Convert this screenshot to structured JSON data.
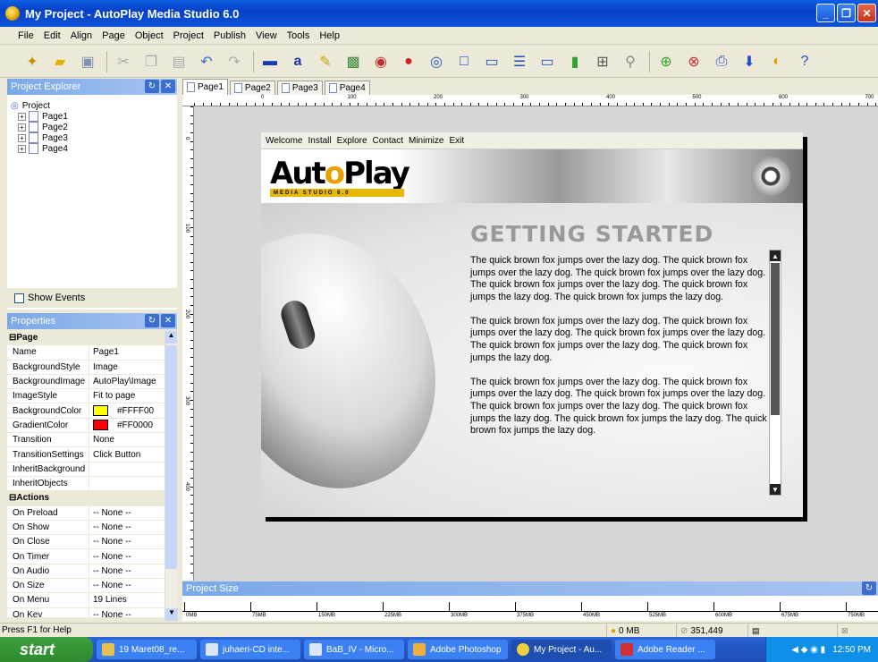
{
  "window": {
    "title": "My Project - AutoPlay Media Studio 6.0"
  },
  "menu": [
    "File",
    "Edit",
    "Align",
    "Page",
    "Object",
    "Project",
    "Publish",
    "View",
    "Tools",
    "Help"
  ],
  "explorer": {
    "title": "Project Explorer",
    "root": "Project",
    "pages": [
      "Page1",
      "Page2",
      "Page3",
      "Page4"
    ],
    "show_events": "Show Events"
  },
  "properties": {
    "title": "Properties",
    "page_section": "Page",
    "page_rows": [
      {
        "k": "Name",
        "v": "Page1"
      },
      {
        "k": "BackgroundStyle",
        "v": "Image"
      },
      {
        "k": "BackgroundImage",
        "v": "AutoPlay\\Image"
      },
      {
        "k": "ImageStyle",
        "v": "Fit to page"
      },
      {
        "k": "BackgroundColor",
        "v": "#FFFF00",
        "color": "#FFFF00"
      },
      {
        "k": "GradientColor",
        "v": "#FF0000",
        "color": "#FF0000"
      },
      {
        "k": "Transition",
        "v": "None"
      },
      {
        "k": "TransitionSettings",
        "v": "Click Button"
      },
      {
        "k": "InheritBackground",
        "v": ""
      },
      {
        "k": "InheritObjects",
        "v": ""
      }
    ],
    "actions_section": "Actions",
    "action_rows": [
      {
        "k": "On Preload",
        "v": "-- None --"
      },
      {
        "k": "On Show",
        "v": "-- None --"
      },
      {
        "k": "On Close",
        "v": "-- None --"
      },
      {
        "k": "On Timer",
        "v": "-- None --"
      },
      {
        "k": "On Audio",
        "v": "-- None --"
      },
      {
        "k": "On Size",
        "v": "-- None --"
      },
      {
        "k": "On Menu",
        "v": "19 Lines"
      },
      {
        "k": "On Key",
        "v": "-- None --"
      }
    ]
  },
  "tabs": [
    "Page1",
    "Page2",
    "Page3",
    "Page4"
  ],
  "ruler_h": [
    "0",
    "100",
    "200",
    "300",
    "400",
    "500",
    "600",
    "700"
  ],
  "ruler_v": [
    "0",
    "100",
    "200",
    "300",
    "400"
  ],
  "stage": {
    "menu": [
      "Welcome",
      "Install",
      "Explore",
      "Contact",
      "Minimize",
      "Exit"
    ],
    "logo_main": "Aut",
    "logo_o": "o",
    "logo_end": "Play",
    "logo_sub": "MEDIA STUDIO 6.0",
    "heading": "GETTING STARTED",
    "paragraphs": [
      "The quick brown fox jumps over the lazy dog. The quick brown fox jumps over the lazy dog. The quick brown fox jumps over the lazy dog. The quick brown fox jumps over the lazy dog. The quick brown fox jumps the lazy dog. The quick brown fox jumps the lazy dog.",
      "The quick brown fox jumps over the lazy dog. The quick brown fox jumps over the lazy dog. The quick brown fox jumps over the lazy dog. The quick brown fox jumps over the lazy dog. The quick brown fox jumps the lazy dog.",
      "The quick brown fox jumps over the lazy dog. The quick brown fox jumps over the lazy dog. The quick brown fox jumps over the lazy dog. The quick brown fox jumps over the lazy dog. The quick brown fox jumps the lazy dog. The quick brown fox jumps the lazy dog. The quick brown fox jumps the lazy dog."
    ]
  },
  "project_size": {
    "title": "Project Size",
    "labels": [
      "0MB",
      "75MB",
      "150MB",
      "225MB",
      "300MB",
      "375MB",
      "450MB",
      "525MB",
      "600MB",
      "675MB",
      "750MB"
    ]
  },
  "status": {
    "help": "Press F1 for Help",
    "size": "0 MB",
    "count": "351,449"
  },
  "taskbar": {
    "start": "start",
    "tasks": [
      "19 Maret08_re...",
      "juhaeri-CD inte...",
      "BaB_IV - Micro...",
      "Adobe Photoshop",
      "My Project - Au...",
      "Adobe Reader ..."
    ],
    "clock": "12:50 PM"
  }
}
